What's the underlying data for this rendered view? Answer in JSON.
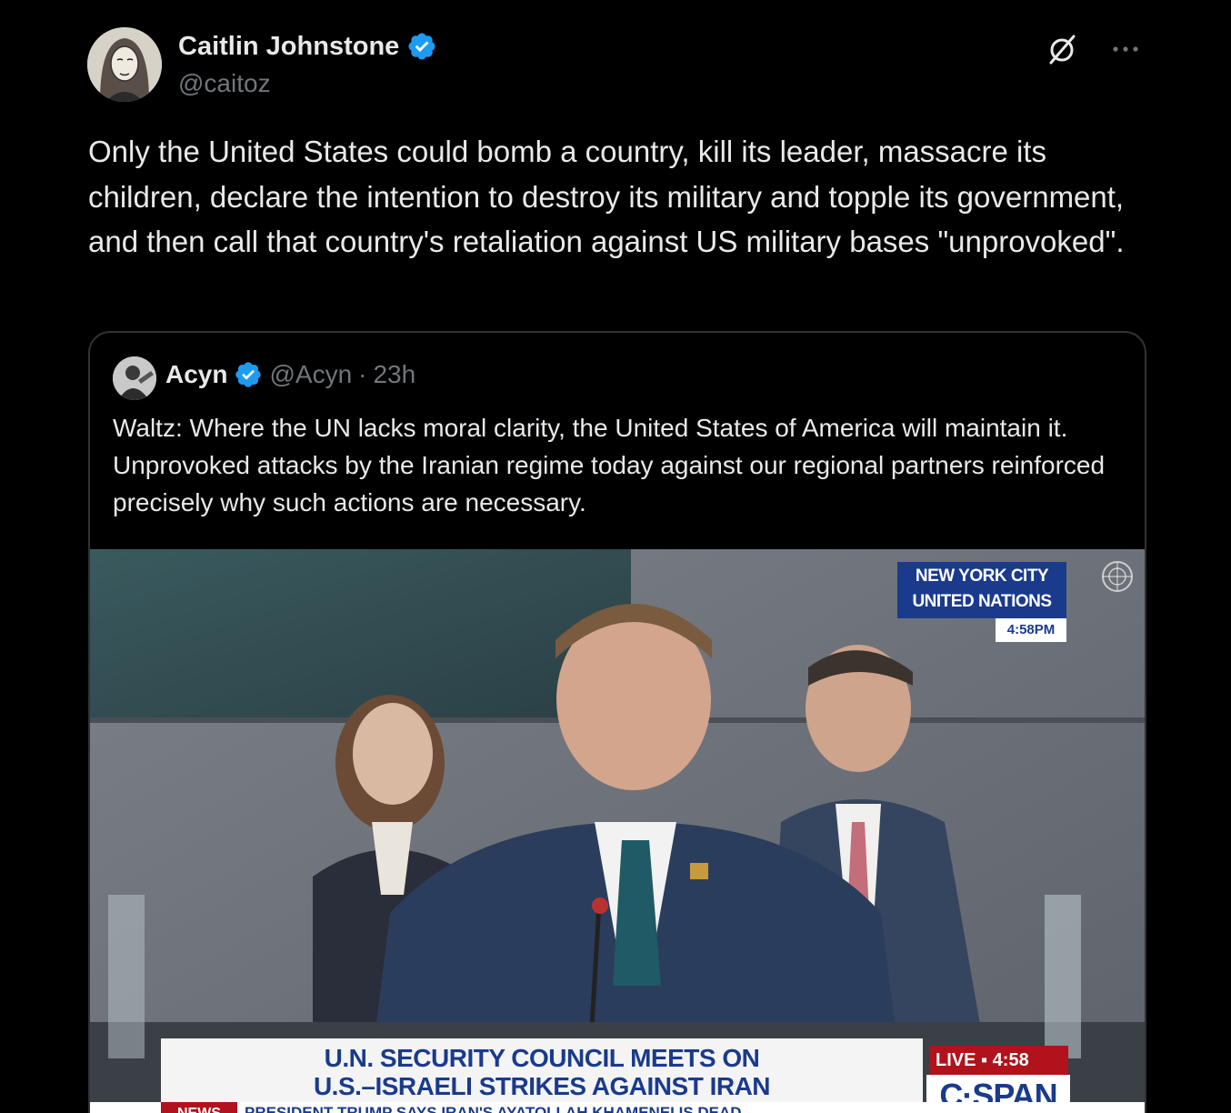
{
  "tweet": {
    "author": {
      "display_name": "Caitlin Johnstone",
      "handle": "@caitoz",
      "verified": true
    },
    "text": "Only the United States could bomb a country, kill its leader, massacre its children, declare the intention to destroy its military and topple its government, and then call that country's retaliation against US military bases \"unprovoked\".",
    "icons": [
      "grok-icon",
      "more-icon"
    ]
  },
  "quote": {
    "author": {
      "display_name": "Acyn",
      "handle": "@Acyn",
      "separator": "·",
      "time": "23h",
      "verified": true
    },
    "text": "Waltz: Where the UN lacks moral clarity, the United States of America will maintain it. Unprovoked attacks by the Iranian regime today against our regional partners reinforced precisely why such actions are necessary.",
    "video": {
      "location_line1": "NEW YORK CITY",
      "location_line2": "UNITED NATIONS",
      "location_time": "4:58PM",
      "headline_line1": "U.N. SECURITY COUNCIL MEETS ON",
      "headline_line2": "U.S.–ISRAELI STRIKES AGAINST IRAN",
      "live_label": "LIVE ▪ 4:58",
      "network": "C·SPAN",
      "ticker_label": "NEWS",
      "ticker_text": "PRESIDENT TRUMP SAYS IRAN'S AYATOLLAH KHAMENEI IS DEAD"
    }
  },
  "colors": {
    "background": "#000000",
    "text_primary": "#e7e9ea",
    "text_secondary": "#71767b",
    "verified_blue": "#1d9bf0",
    "border": "#2f3336",
    "cspan_blue": "#1a3a8c",
    "cspan_red": "#b1121b"
  }
}
